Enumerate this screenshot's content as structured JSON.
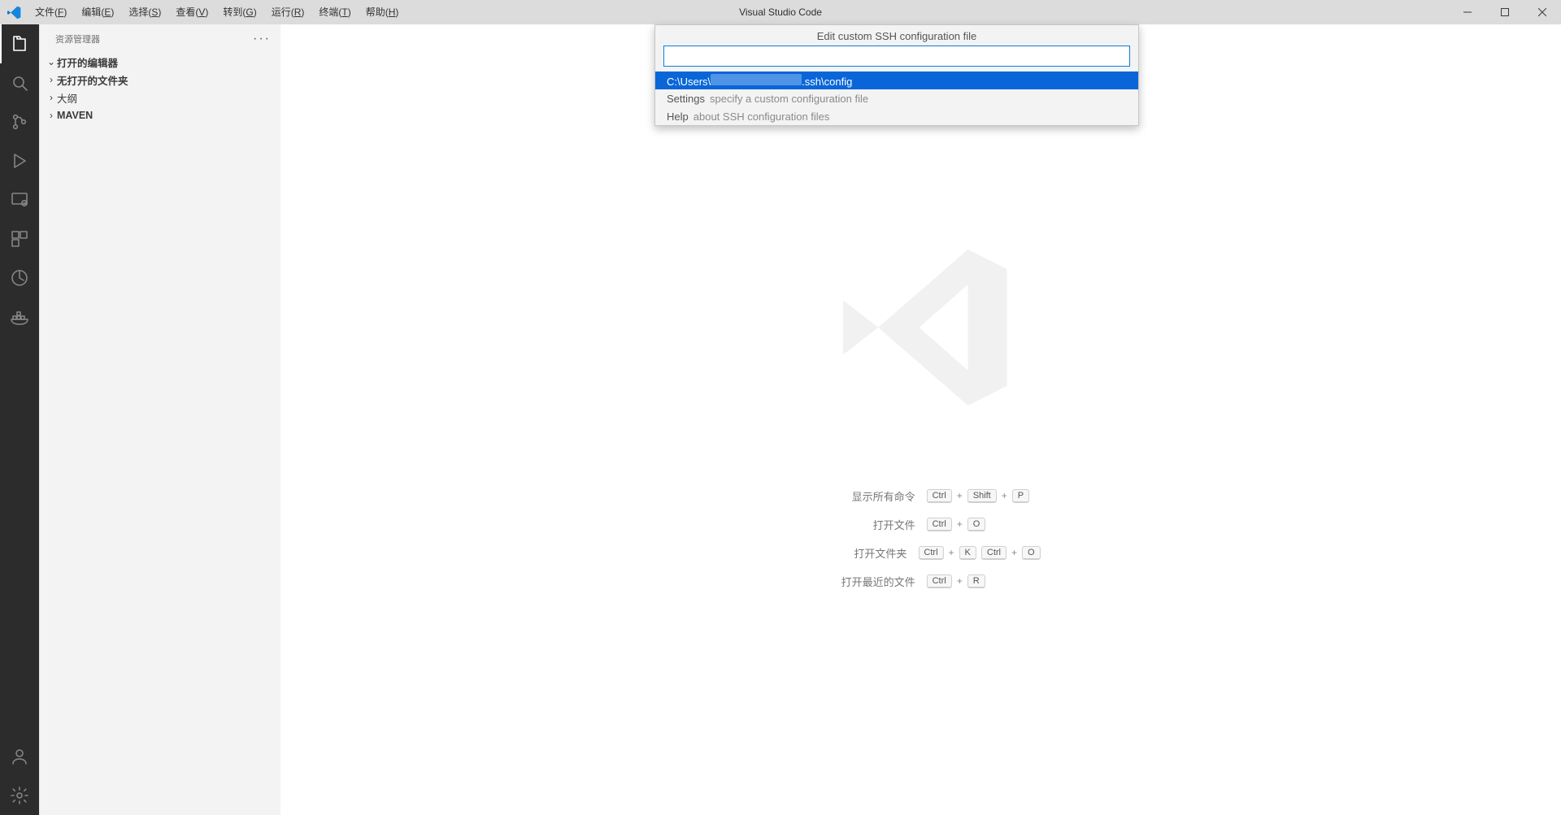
{
  "titlebar": {
    "app_title": "Visual Studio Code",
    "menu": [
      {
        "pre": "文件(",
        "u": "F",
        "post": ")"
      },
      {
        "pre": "编辑(",
        "u": "E",
        "post": ")"
      },
      {
        "pre": "选择(",
        "u": "S",
        "post": ")"
      },
      {
        "pre": "查看(",
        "u": "V",
        "post": ")"
      },
      {
        "pre": "转到(",
        "u": "G",
        "post": ")"
      },
      {
        "pre": "运行(",
        "u": "R",
        "post": ")"
      },
      {
        "pre": "终端(",
        "u": "T",
        "post": ")"
      },
      {
        "pre": "帮助(",
        "u": "H",
        "post": ")"
      }
    ]
  },
  "sidebar": {
    "title": "资源管理器",
    "sections": [
      {
        "label": "打开的编辑器",
        "expanded": true,
        "bold": true
      },
      {
        "label": "无打开的文件夹",
        "expanded": false,
        "bold": true
      },
      {
        "label": "大纲",
        "expanded": false,
        "bold": false
      },
      {
        "label": "MAVEN",
        "expanded": false,
        "bold": true
      }
    ]
  },
  "activitybar": {
    "top": [
      "explorer",
      "search",
      "source-control",
      "run-debug",
      "remote-explorer",
      "extensions",
      "custom-1",
      "docker"
    ],
    "bottom": [
      "accounts",
      "settings"
    ]
  },
  "quickpick": {
    "title": "Edit custom SSH configuration file",
    "input_value": "",
    "rows": [
      {
        "selected": true,
        "label_pre": "C:\\Users\\",
        "masked": true,
        "label_post": ".ssh\\config",
        "desc": ""
      },
      {
        "selected": false,
        "label_pre": "Settings",
        "masked": false,
        "label_post": "",
        "desc": "specify a custom configuration file"
      },
      {
        "selected": false,
        "label_pre": "Help",
        "masked": false,
        "label_post": "",
        "desc": "about SSH configuration files"
      }
    ]
  },
  "shortcuts": [
    {
      "label": "显示所有命令",
      "keys": [
        "Ctrl",
        "+",
        "Shift",
        "+",
        "P"
      ]
    },
    {
      "label": "打开文件",
      "keys": [
        "Ctrl",
        "+",
        "O"
      ]
    },
    {
      "label": "打开文件夹",
      "keys": [
        "Ctrl",
        "+",
        "K",
        "Ctrl",
        "+",
        "O"
      ]
    },
    {
      "label": "打开最近的文件",
      "keys": [
        "Ctrl",
        "+",
        "R"
      ]
    }
  ]
}
